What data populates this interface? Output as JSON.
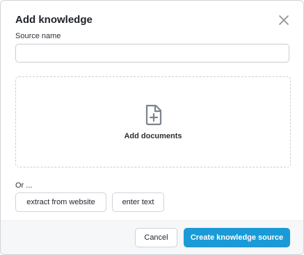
{
  "dialog": {
    "title": "Add knowledge",
    "close_icon": "close-icon"
  },
  "source": {
    "label": "Source name",
    "value": "",
    "placeholder": ""
  },
  "dropzone": {
    "icon": "file-add-icon",
    "label": "Add documents"
  },
  "alternatives": {
    "or_label": "Or ...",
    "extract_label": "extract from website",
    "enter_label": "enter text"
  },
  "footer": {
    "cancel_label": "Cancel",
    "create_label": "Create knowledge source"
  },
  "colors": {
    "accent": "#1a9bd7",
    "footer_bg": "#f5f7f9",
    "border": "#cfd3d8",
    "icon": "#7d838b"
  }
}
